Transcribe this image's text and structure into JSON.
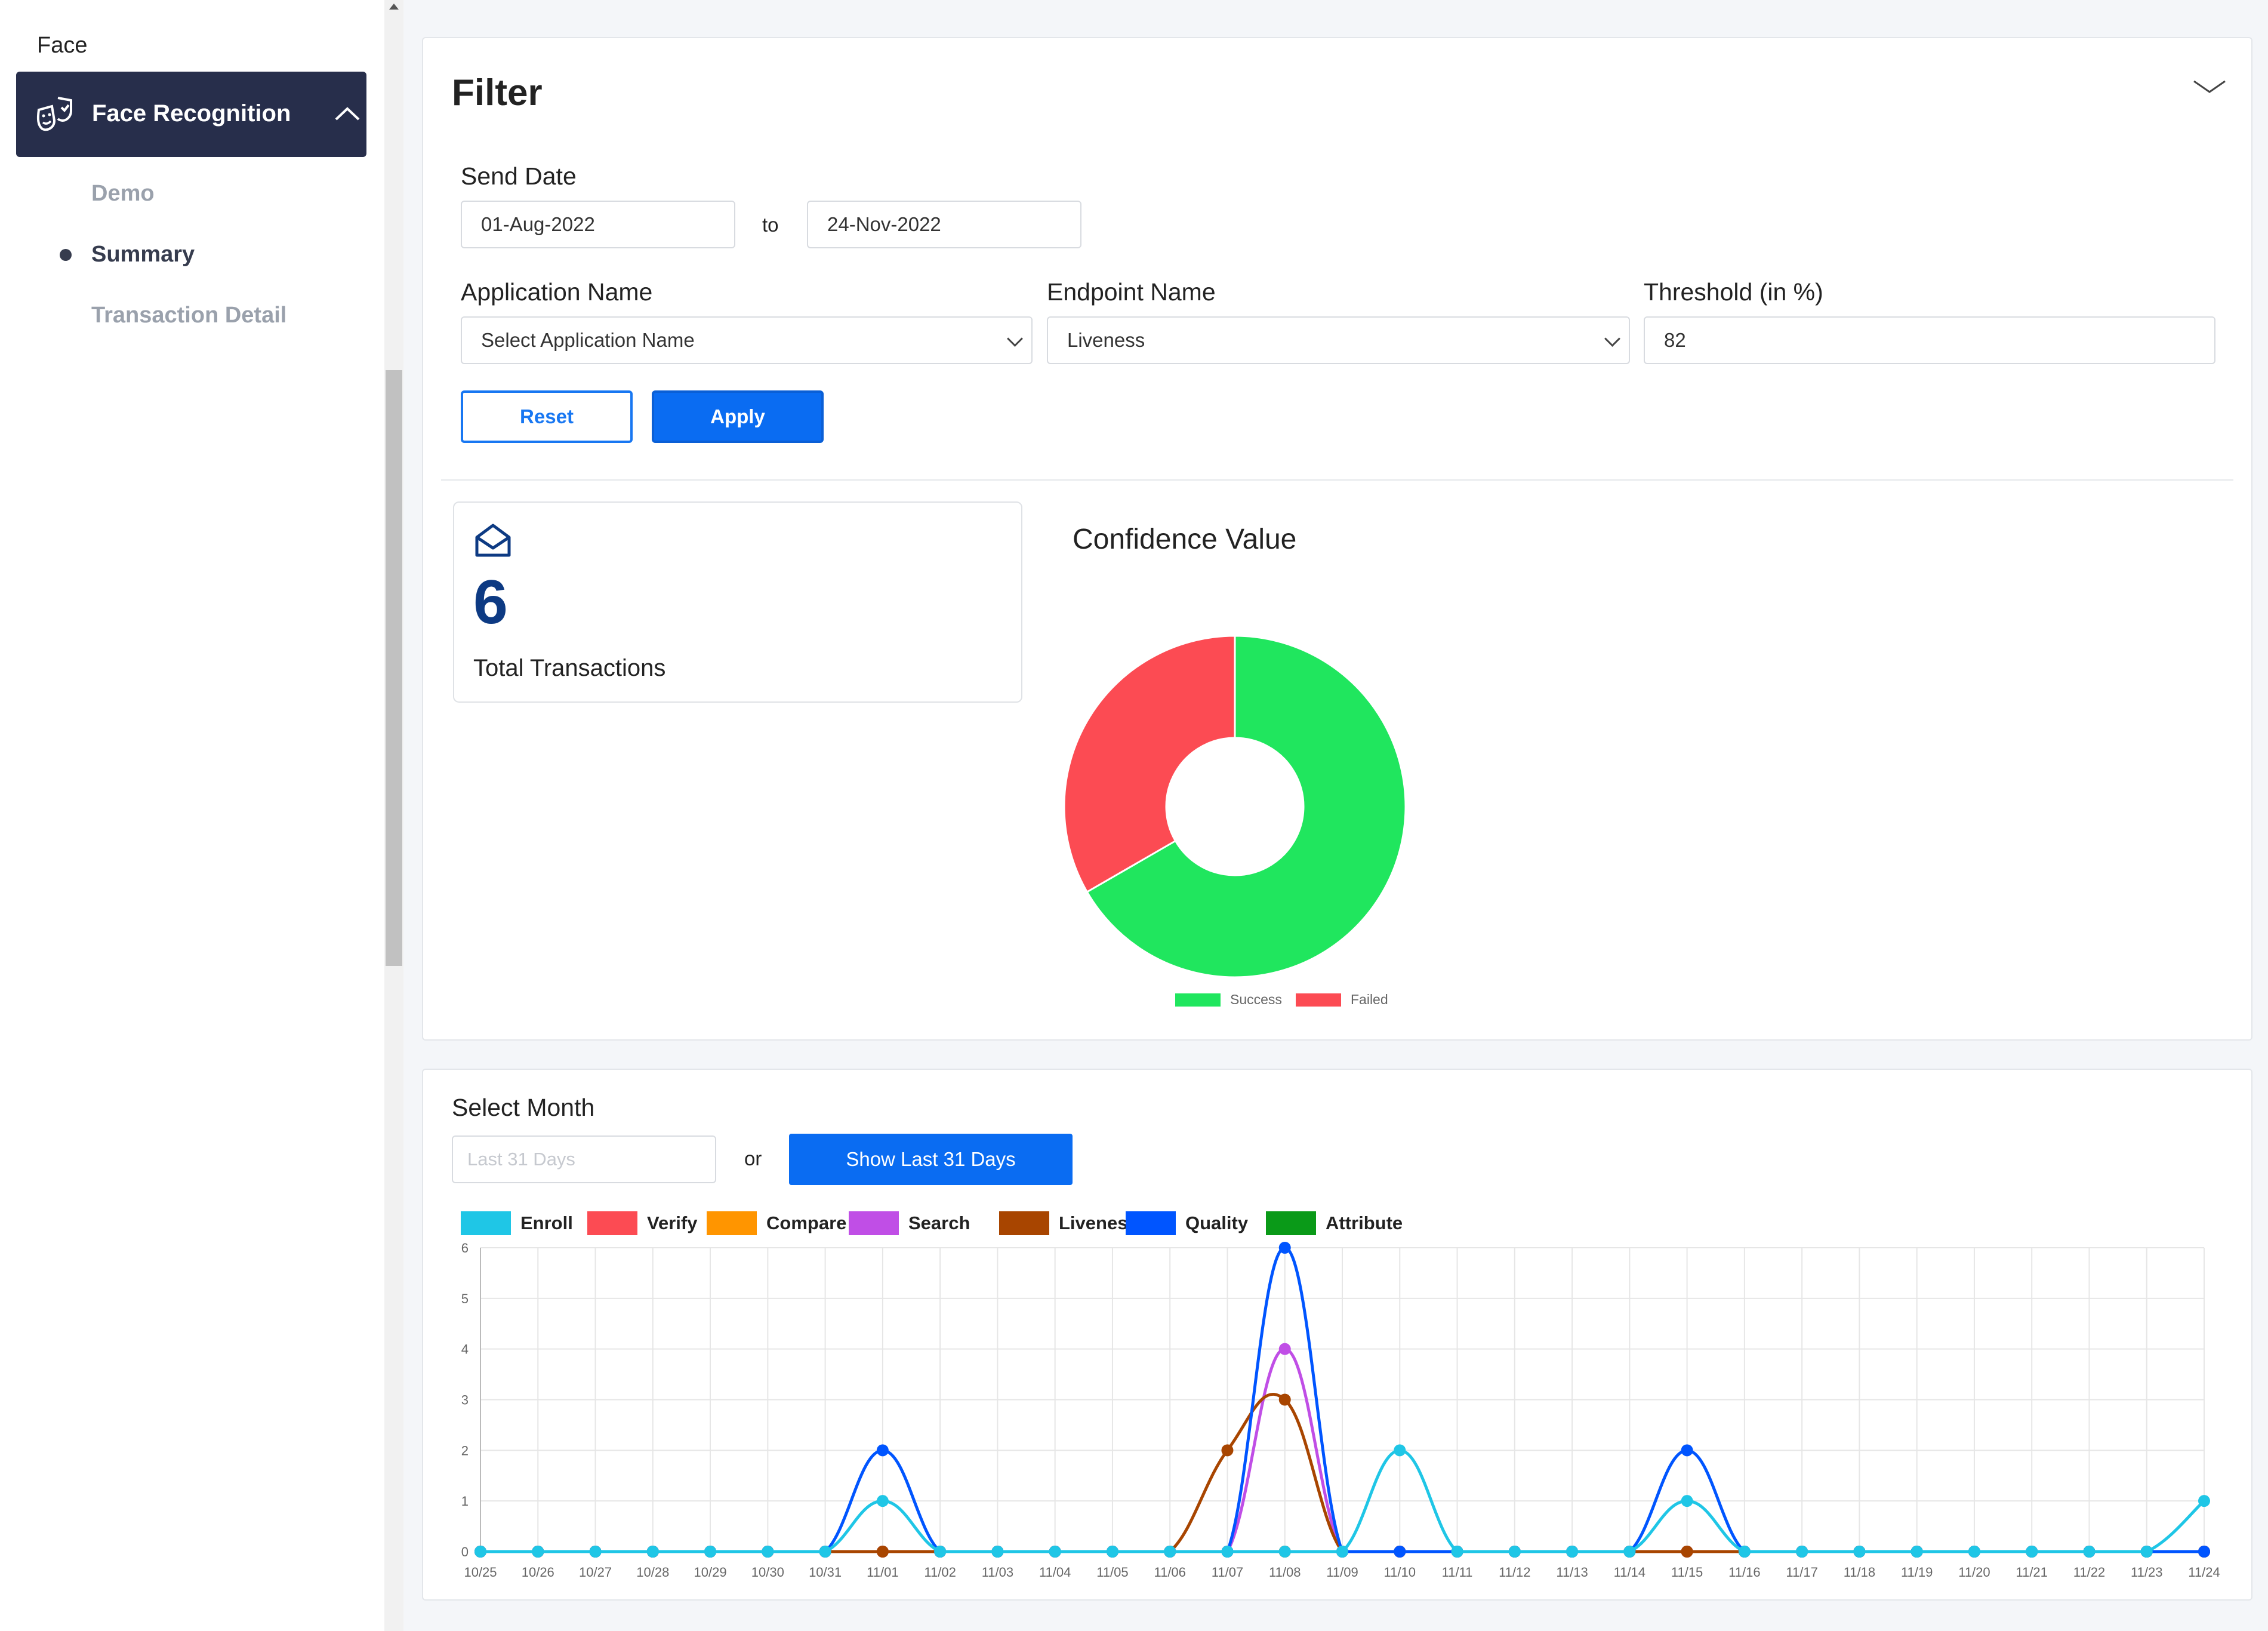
{
  "sidebar": {
    "section_title": "Face",
    "group_label": "Face Recognition",
    "items": [
      {
        "label": "Demo"
      },
      {
        "label": "Summary"
      },
      {
        "label": "Transaction Detail"
      }
    ]
  },
  "filter": {
    "title": "Filter",
    "send_date_label": "Send Date",
    "date_from": "01-Aug-2022",
    "date_sep": "to",
    "date_to": "24-Nov-2022",
    "app_name_label": "Application Name",
    "app_name_value": "Select Application Name",
    "endpoint_label": "Endpoint Name",
    "endpoint_value": "Liveness",
    "threshold_label": "Threshold (in %)",
    "threshold_value": "82",
    "reset_label": "Reset",
    "apply_label": "Apply"
  },
  "summary": {
    "total_count": "6",
    "total_label": "Total Transactions",
    "confidence_title": "Confidence Value"
  },
  "colors": {
    "success": "#20e65e",
    "failed": "#fc4b53",
    "sidebar_active": "#272e4b",
    "primary": "#0a6cf2"
  },
  "donut": {
    "type": "pie",
    "series": [
      {
        "name": "Success",
        "value": 4,
        "color": "#20e65e"
      },
      {
        "name": "Failed",
        "value": 2,
        "color": "#fc4b53"
      }
    ]
  },
  "month": {
    "select_label": "Select Month",
    "placeholder": "Last 31 Days",
    "or_text": "or",
    "button_label": "Show Last 31 Days"
  },
  "chart_data": {
    "type": "line",
    "x": [
      "10/25",
      "10/26",
      "10/27",
      "10/28",
      "10/29",
      "10/30",
      "10/31",
      "11/01",
      "11/02",
      "11/03",
      "11/04",
      "11/05",
      "11/06",
      "11/07",
      "11/08",
      "11/09",
      "11/10",
      "11/11",
      "11/12",
      "11/13",
      "11/14",
      "11/15",
      "11/16",
      "11/17",
      "11/18",
      "11/19",
      "11/20",
      "11/21",
      "11/22",
      "11/23",
      "11/24"
    ],
    "ylim": [
      0,
      6
    ],
    "yticks": [
      0,
      1,
      2,
      3,
      4,
      5,
      6
    ],
    "grid": true,
    "legend_position": "top-left",
    "series": [
      {
        "name": "Enroll",
        "color": "#1fc6e6",
        "values": [
          0,
          0,
          0,
          0,
          0,
          0,
          0,
          1,
          0,
          0,
          0,
          0,
          0,
          0,
          0,
          0,
          2,
          0,
          0,
          0,
          0,
          1,
          0,
          0,
          0,
          0,
          0,
          0,
          0,
          0,
          1
        ]
      },
      {
        "name": "Verify",
        "color": "#fc4b53",
        "values": [
          0,
          0,
          0,
          0,
          0,
          0,
          0,
          0,
          0,
          0,
          0,
          0,
          0,
          0,
          0,
          0,
          0,
          0,
          0,
          0,
          0,
          0,
          0,
          0,
          0,
          0,
          0,
          0,
          0,
          0,
          0
        ]
      },
      {
        "name": "Compare",
        "color": "#ff9500",
        "values": [
          0,
          0,
          0,
          0,
          0,
          0,
          0,
          0,
          0,
          0,
          0,
          0,
          0,
          0,
          0,
          0,
          0,
          0,
          0,
          0,
          0,
          0,
          0,
          0,
          0,
          0,
          0,
          0,
          0,
          0,
          0
        ]
      },
      {
        "name": "Search",
        "color": "#c04ee6",
        "values": [
          0,
          0,
          0,
          0,
          0,
          0,
          0,
          0,
          0,
          0,
          0,
          0,
          0,
          0,
          4,
          0,
          0,
          0,
          0,
          0,
          0,
          0,
          0,
          0,
          0,
          0,
          0,
          0,
          0,
          0,
          0
        ]
      },
      {
        "name": "Liveness",
        "color": "#a84500",
        "values": [
          0,
          0,
          0,
          0,
          0,
          0,
          0,
          0,
          0,
          0,
          0,
          0,
          0,
          2,
          3,
          0,
          0,
          0,
          0,
          0,
          0,
          0,
          0,
          0,
          0,
          0,
          0,
          0,
          0,
          0,
          0
        ]
      },
      {
        "name": "Quality",
        "color": "#0055ff",
        "values": [
          0,
          0,
          0,
          0,
          0,
          0,
          0,
          2,
          0,
          0,
          0,
          0,
          0,
          0,
          6,
          0,
          0,
          0,
          0,
          0,
          0,
          2,
          0,
          0,
          0,
          0,
          0,
          0,
          0,
          0,
          0
        ]
      },
      {
        "name": "Attribute",
        "color": "#0a9a18",
        "values": [
          0,
          0,
          0,
          0,
          0,
          0,
          0,
          0,
          0,
          0,
          0,
          0,
          0,
          0,
          0,
          0,
          0,
          0,
          0,
          0,
          0,
          0,
          0,
          0,
          0,
          0,
          0,
          0,
          0,
          0,
          0
        ]
      }
    ]
  }
}
